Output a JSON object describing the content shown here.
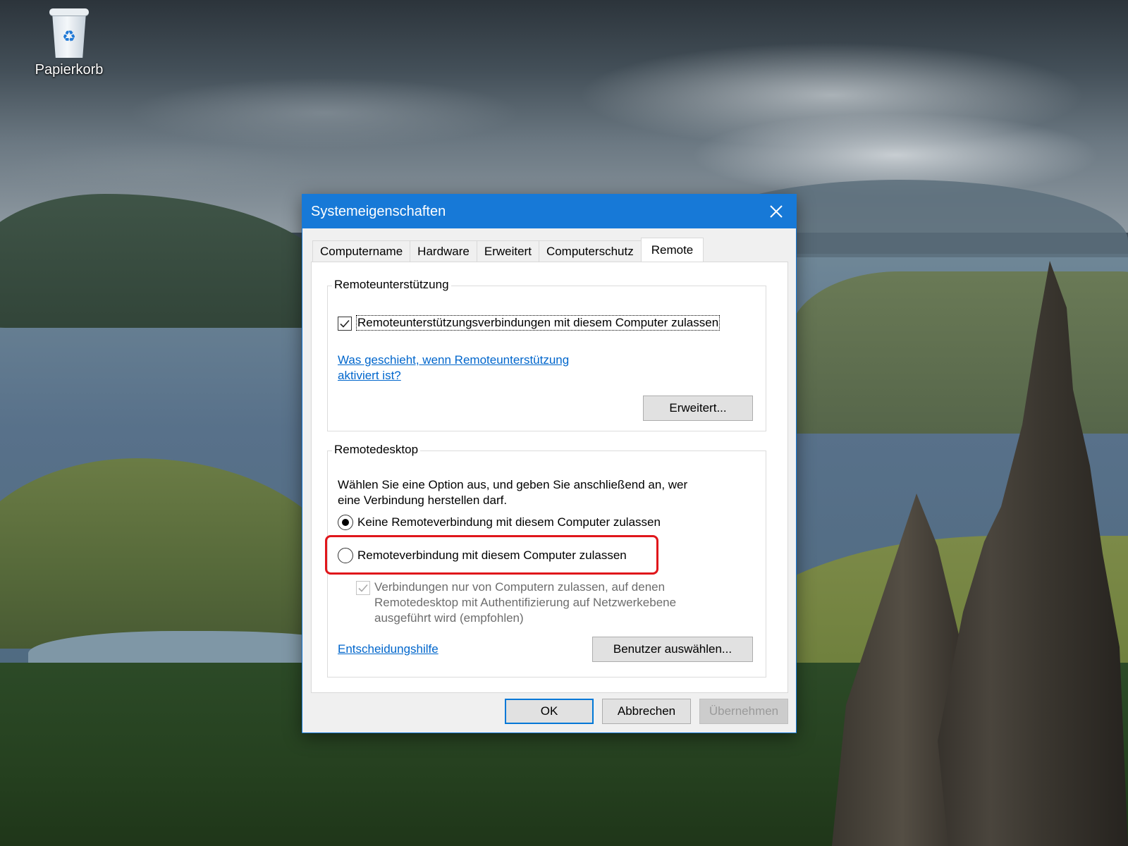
{
  "desktop": {
    "icon_label": "Papierkorb"
  },
  "dialog": {
    "title": "Systemeigenschaften",
    "tabs": [
      {
        "label": "Computername"
      },
      {
        "label": "Hardware"
      },
      {
        "label": "Erweitert"
      },
      {
        "label": "Computerschutz"
      },
      {
        "label": "Remote"
      }
    ],
    "active_tab": "Remote",
    "remote_assistance": {
      "group_title": "Remoteunterstützung",
      "allow_checkbox_label": "Remoteunterstützungsverbindungen mit diesem Computer zulassen",
      "allow_checked": true,
      "help_link_line1": "Was geschieht, wenn Remoteunterstützung",
      "help_link_line2": "aktiviert ist?",
      "advanced_button": "Erweitert..."
    },
    "remote_desktop": {
      "group_title": "Remotedesktop",
      "description_line1": "Wählen Sie eine Option aus, und geben Sie anschließend an, wer",
      "description_line2": "eine Verbindung herstellen darf.",
      "option_deny": "Keine Remoteverbindung mit diesem Computer zulassen",
      "option_allow": "Remoteverbindung mit diesem Computer zulassen",
      "selected_option": "Keine Remoteverbindung mit diesem Computer zulassen",
      "nla_line1": "Verbindungen nur von Computern zulassen, auf denen",
      "nla_line2": "Remotedesktop mit Authentifizierung auf Netzwerkebene",
      "nla_line3": "ausgeführt wird (empfohlen)",
      "nla_checked": true,
      "nla_enabled": false,
      "help_link": "Entscheidungshilfe",
      "select_users_button": "Benutzer auswählen..."
    },
    "footer": {
      "ok": "OK",
      "cancel": "Abbrechen",
      "apply": "Übernehmen"
    }
  },
  "colors": {
    "titlebar": "#1779d7",
    "link": "#0066cc",
    "highlight": "#e0161b"
  }
}
